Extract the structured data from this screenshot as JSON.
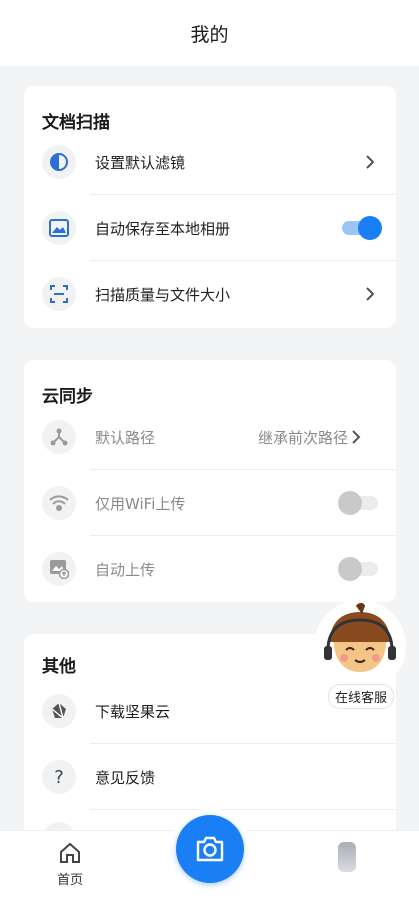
{
  "header": {
    "title": "我的"
  },
  "doc_scan": {
    "title": "文档扫描",
    "items": [
      {
        "label": "设置默认滤镜",
        "icon": "contrast-icon"
      },
      {
        "label": "自动保存至本地相册",
        "icon": "image-icon",
        "toggle": true
      },
      {
        "label": "扫描质量与文件大小",
        "icon": "scan-frame-icon"
      }
    ]
  },
  "cloud_sync": {
    "title": "云同步",
    "items": [
      {
        "label": "默认路径",
        "value": "继承前次路径",
        "icon": "share-nodes-icon"
      },
      {
        "label": "仅用WiFi上传",
        "icon": "wifi-icon",
        "toggle": false
      },
      {
        "label": "自动上传",
        "icon": "photo-upload-icon",
        "toggle": false
      }
    ]
  },
  "other": {
    "title": "其他",
    "items": [
      {
        "label": "下载坚果云",
        "icon": "nut-logo-icon"
      },
      {
        "label": "意见反馈",
        "icon": "question-icon"
      }
    ]
  },
  "customer_service": {
    "label": "在线客服"
  },
  "bottom_nav": {
    "home_label": "首页"
  },
  "colors": {
    "accent": "#1a7ff5",
    "background": "#f3f4f6"
  }
}
